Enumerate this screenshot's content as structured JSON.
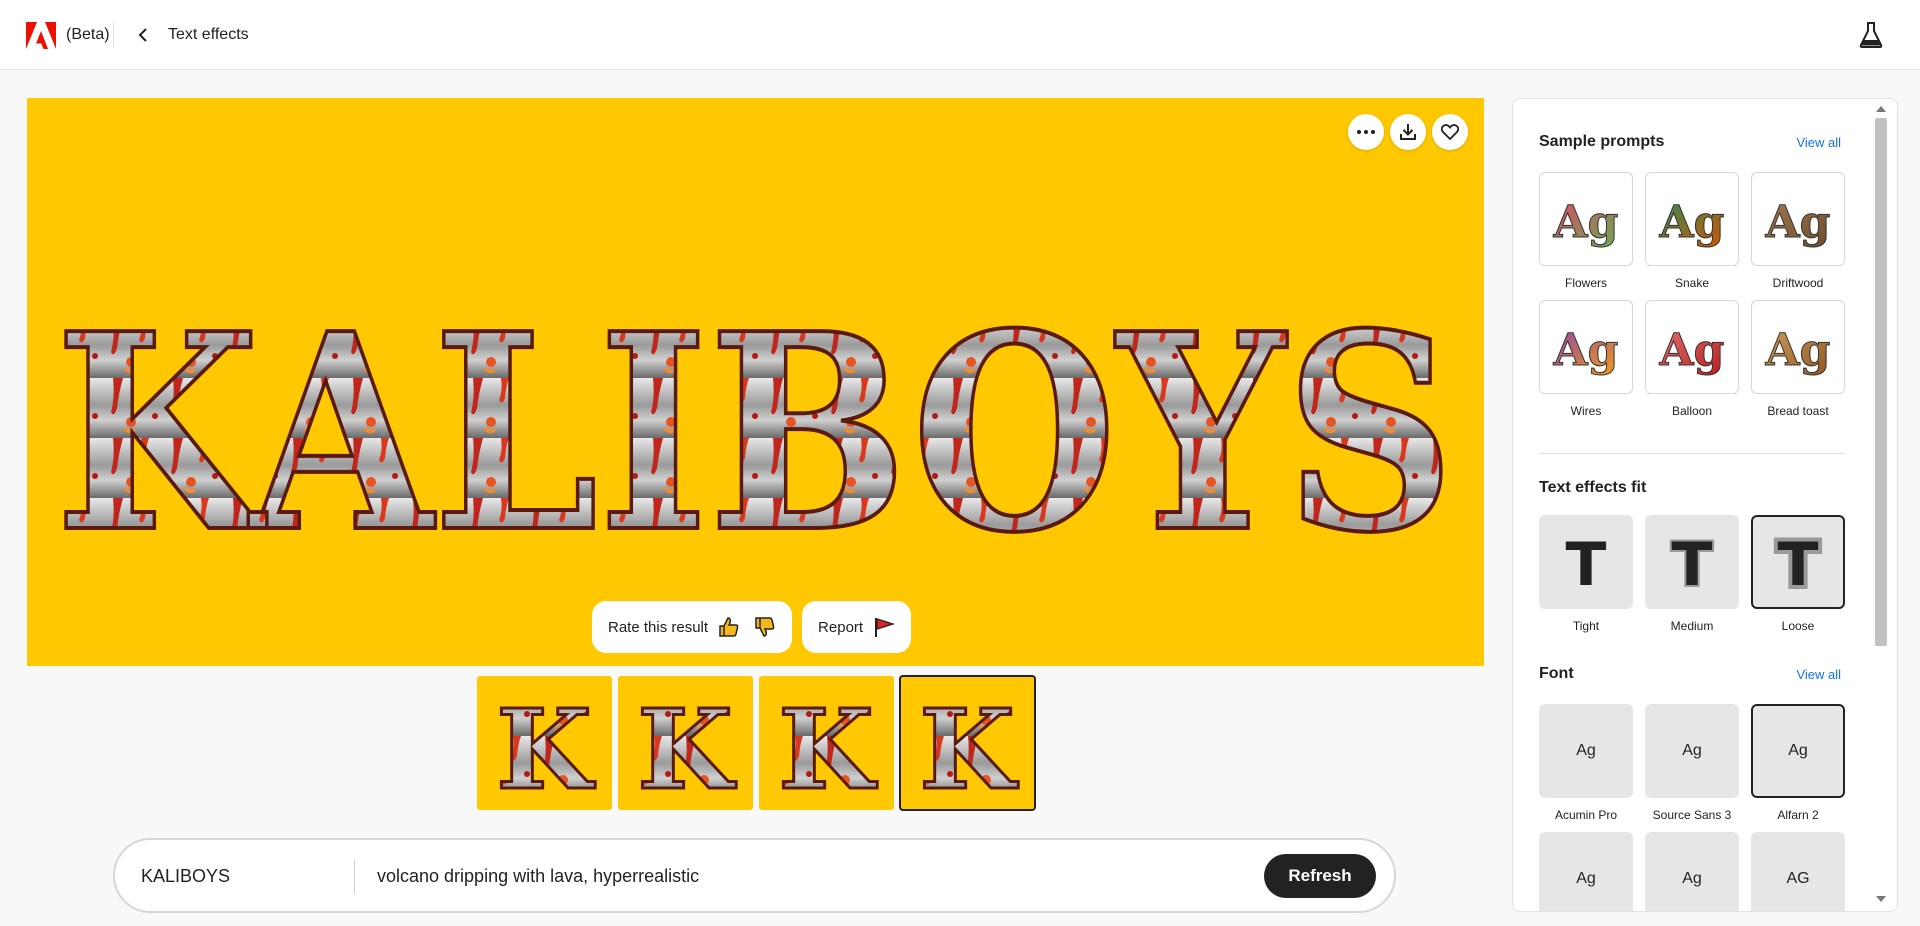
{
  "app": {
    "badge": "(Beta)",
    "title": "Text effects"
  },
  "preview": {
    "word": "KALIBOYS",
    "rate_label": "Rate this result",
    "report_label": "Report"
  },
  "prompt": {
    "text_value": "KALIBOYS",
    "prompt_value": "volcano dripping with lava, hyperrealistic",
    "refresh_label": "Refresh"
  },
  "thumbnails": [
    {
      "letter": "K",
      "selected": false
    },
    {
      "letter": "K",
      "selected": false
    },
    {
      "letter": "K",
      "selected": false
    },
    {
      "letter": "K",
      "selected": true
    }
  ],
  "panel": {
    "sample_prompts": {
      "title": "Sample prompts",
      "view_all": "View all",
      "items": [
        {
          "label": "Flowers",
          "sample": "Ag",
          "colors": [
            "#d94b6a",
            "#6aa84f"
          ]
        },
        {
          "label": "Snake",
          "sample": "Ag",
          "colors": [
            "#2e8b57",
            "#d35400"
          ]
        },
        {
          "label": "Driftwood",
          "sample": "Ag",
          "colors": [
            "#a67c52",
            "#6b4a2b"
          ]
        },
        {
          "label": "Wires",
          "sample": "Ag",
          "colors": [
            "#8e44ad",
            "#f39c12"
          ]
        },
        {
          "label": "Balloon",
          "sample": "Ag",
          "colors": [
            "#e57373",
            "#b71c1c"
          ]
        },
        {
          "label": "Bread toast",
          "sample": "Ag",
          "colors": [
            "#d2a05a",
            "#8d5524"
          ]
        }
      ]
    },
    "fit": {
      "title": "Text effects fit",
      "items": [
        {
          "label": "Tight",
          "sample": "T",
          "selected": false
        },
        {
          "label": "Medium",
          "sample": "T",
          "selected": false
        },
        {
          "label": "Loose",
          "sample": "T",
          "selected": true
        }
      ]
    },
    "font": {
      "title": "Font",
      "view_all": "View all",
      "items": [
        {
          "label": "Acumin Pro",
          "sample": "Ag",
          "selected": false
        },
        {
          "label": "Source Sans 3",
          "sample": "Ag",
          "selected": false
        },
        {
          "label": "Alfarn 2",
          "sample": "Ag",
          "selected": true
        },
        {
          "label": "",
          "sample": "Ag",
          "selected": false
        },
        {
          "label": "",
          "sample": "Ag",
          "selected": false
        },
        {
          "label": "",
          "sample": "AG",
          "selected": false
        }
      ]
    }
  },
  "colors": {
    "canvas_bg": "#ffc800",
    "accent_link": "#1473e6",
    "adobe_red": "#eb1000",
    "button_dark": "#222222"
  }
}
